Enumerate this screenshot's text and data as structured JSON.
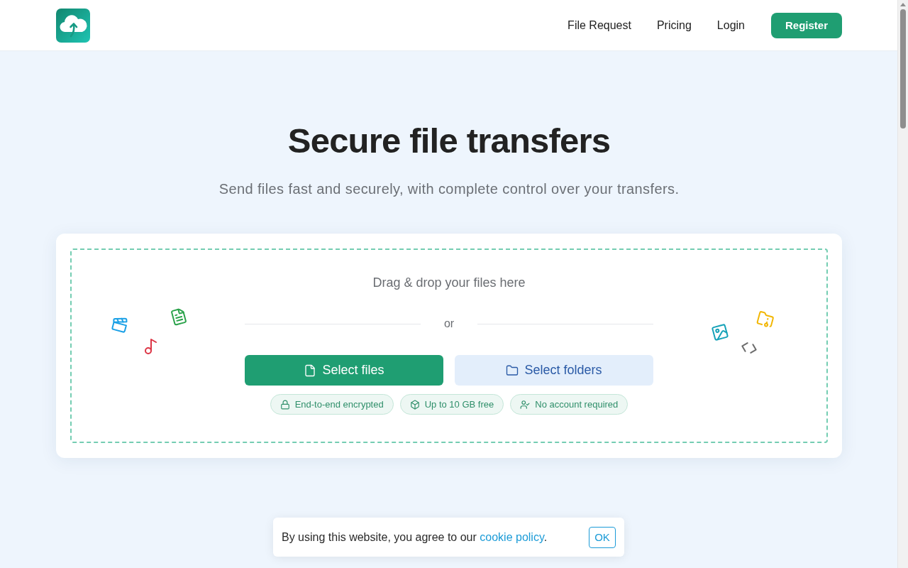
{
  "header": {
    "nav": [
      {
        "label": "File Request"
      },
      {
        "label": "Pricing"
      },
      {
        "label": "Login"
      }
    ],
    "register_button": "Register"
  },
  "hero": {
    "title": "Secure file transfers",
    "subtitle": "Send files fast and securely, with complete control over your transfers."
  },
  "upload": {
    "prompt": "Drag & drop your files here",
    "divider": "or",
    "buttons": [
      {
        "label": "Select files",
        "kind": "primary"
      },
      {
        "label": "Select folders",
        "kind": "secondary"
      }
    ],
    "badges": [
      {
        "label": "End-to-end encrypted"
      },
      {
        "label": "Up to 10 GB free"
      },
      {
        "label": "No account required"
      }
    ]
  },
  "cookie_banner": {
    "text": "By using this website, you agree to our",
    "link": "cookie policy",
    "end": ".",
    "button": "OK"
  }
}
